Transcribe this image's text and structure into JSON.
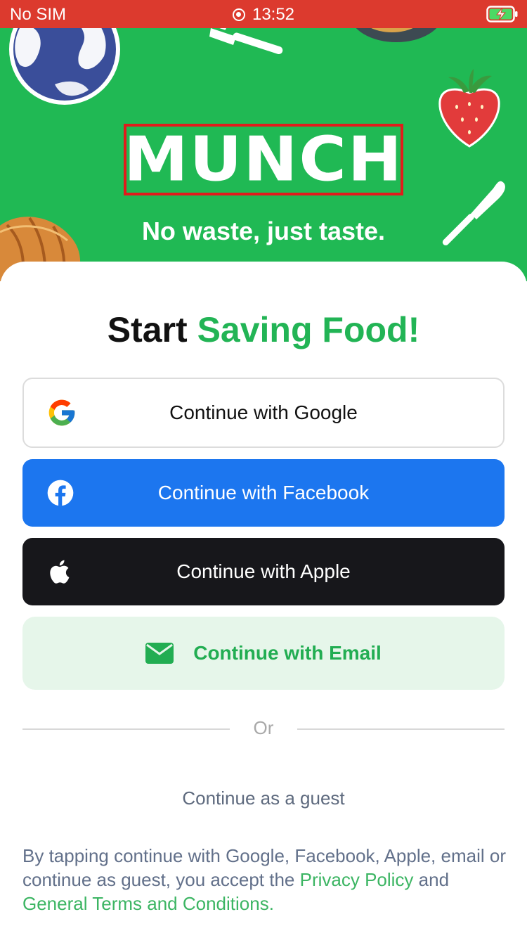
{
  "status_bar": {
    "carrier": "No SIM",
    "time": "13:52",
    "background": "#dc3a2e"
  },
  "hero": {
    "logo": "MUNCH",
    "tagline": "No waste, just taste.",
    "background": "#20b954",
    "decorations": [
      "globe-icon",
      "fork-icon",
      "food-bowl-icon",
      "strawberry-icon",
      "croissant-icon",
      "knife-icon"
    ]
  },
  "sheet": {
    "headline_start": "Start",
    "headline_accent": "Saving Food!",
    "accent_color": "#22b455"
  },
  "buttons": {
    "google": {
      "label": "Continue with Google",
      "icon": "google-icon"
    },
    "facebook": {
      "label": "Continue with Facebook",
      "icon": "facebook-icon",
      "color": "#1c76ef"
    },
    "apple": {
      "label": "Continue with Apple",
      "icon": "apple-icon",
      "color": "#17171b"
    },
    "email": {
      "label": "Continue with Email",
      "icon": "envelope-icon",
      "color": "#e6f6ea"
    }
  },
  "divider": {
    "label": "Or"
  },
  "guest": {
    "label": "Continue as a guest"
  },
  "legal": {
    "text_before": "By tapping continue with Google, Facebook, Apple, email or continue as guest, you accept the ",
    "privacy_link": "Privacy Policy",
    "text_middle": " and ",
    "terms_link": "General Terms and Conditions."
  }
}
